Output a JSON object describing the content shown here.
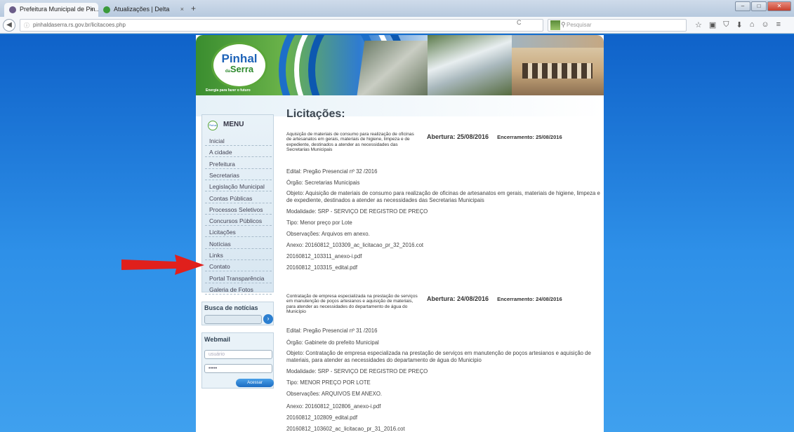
{
  "browser": {
    "tabs": [
      {
        "label": "Prefeitura Municipal de Pin...",
        "close": "×",
        "fav_color": "#6c5e8a"
      },
      {
        "label": "Atualizações | Delta",
        "close": "×",
        "fav_color": "#3a9a3a"
      }
    ],
    "new_tab": "+",
    "url": "pinhaldaserra.rs.gov.br/licitacoes.php",
    "url_info": "ⓘ",
    "reload": "C",
    "search_placeholder": "Pesquisar",
    "toolbar_icons": [
      "☆",
      "▣",
      "⛉",
      "⬇",
      "⌂",
      "☺",
      "≡"
    ],
    "window_buttons": [
      "–",
      "□",
      "✕"
    ]
  },
  "site": {
    "logo": {
      "line1": "Pinhal",
      "line2": "Serra",
      "small": "da"
    },
    "tagline": "Energia para fazer o futuro",
    "menu": {
      "title": "MENU",
      "icon_text": "Pinhal",
      "items": [
        "Inicial",
        "A cidade",
        "Prefeitura",
        "Secretarias",
        "Legislação Municipal",
        "Contas Públicas",
        "Processos Seletivos",
        "Concursos Públicos",
        "Licitações",
        "Notícias",
        "Links",
        "Contato",
        "Portal Transparência",
        "Galeria de Fotos"
      ]
    },
    "news_search": {
      "title": "Busca de notícias",
      "button": "›"
    },
    "webmail": {
      "title": "Webmail",
      "user_placeholder": "usuário",
      "password_value": "•••••",
      "button": "Acessar"
    }
  },
  "page": {
    "title": "Licitações:",
    "entries": [
      {
        "summary": "Aquisição de materiais de consumo para realização de oficinas de artesanatos em gerais, materiais de higiene, limpeza e de expediente, destinados a atender as necessidades das Secretarias Municipais",
        "opening": "Abertura: 25/08/2016",
        "closing": "Encerramento: 25/08/2016",
        "edital": "Edital: Pregão Presencial nº 32 /2016",
        "orgao": "Órgão: Secretarias Municipais",
        "objeto": "Objeto: Aquisição de materiais de consumo para realização de oficinas de artesanatos em gerais, materiais de higiene, limpeza e de expediente, destinados a atender as necessidades das Secretarias Municipais",
        "modalidade": "Modalidade: SRP - SERVIÇO DE REGISTRO DE PREÇO",
        "tipo": "Tipo: Menor preço por Lote",
        "observacoes": "Observações: Arquivos em anexo.",
        "anexo": "Anexo: 20160812_103309_ac_licitacao_pr_32_2016.cot",
        "files": [
          "20160812_103311_anexo-i.pdf",
          "20160812_103315_edital.pdf"
        ]
      },
      {
        "summary": "Contratação de empresa especializada na prestação de serviços em manutenção de poços artesianos e aquisição de materiais, para atender as necessidades do departamento de água do Município",
        "opening": "Abertura: 24/08/2016",
        "closing": "Encerramento: 24/08/2016",
        "edital": "Edital: Pregão Presencial nº 31 /2016",
        "orgao": "Órgão: Gabinete do prefeito Municipal",
        "objeto": "Objeto: Contratação de empresa especializada na prestação de serviços em manutenção de poços artesianos e aquisição de materiais, para atender as necessidades do departamento de água do Municipio",
        "modalidade": "Modalidade: SRP - SERVIÇO DE REGISTRO DE PREÇO",
        "tipo": "Tipo: MENOR PREÇO POR LOTE",
        "observacoes": "Observações: ARQUIVOS EM ANEXO.",
        "anexo": "Anexo: 20160812_102806_anexo-i.pdf",
        "files": [
          "20160812_102809_edital.pdf",
          "20160812_103602_ac_licitacao_pr_31_2016.cot"
        ]
      }
    ]
  },
  "colors": {
    "page_bg": "#1e7fd8",
    "arrow": "#e0201c",
    "brand_green": "#5aa639",
    "brand_blue": "#1e63b8"
  }
}
